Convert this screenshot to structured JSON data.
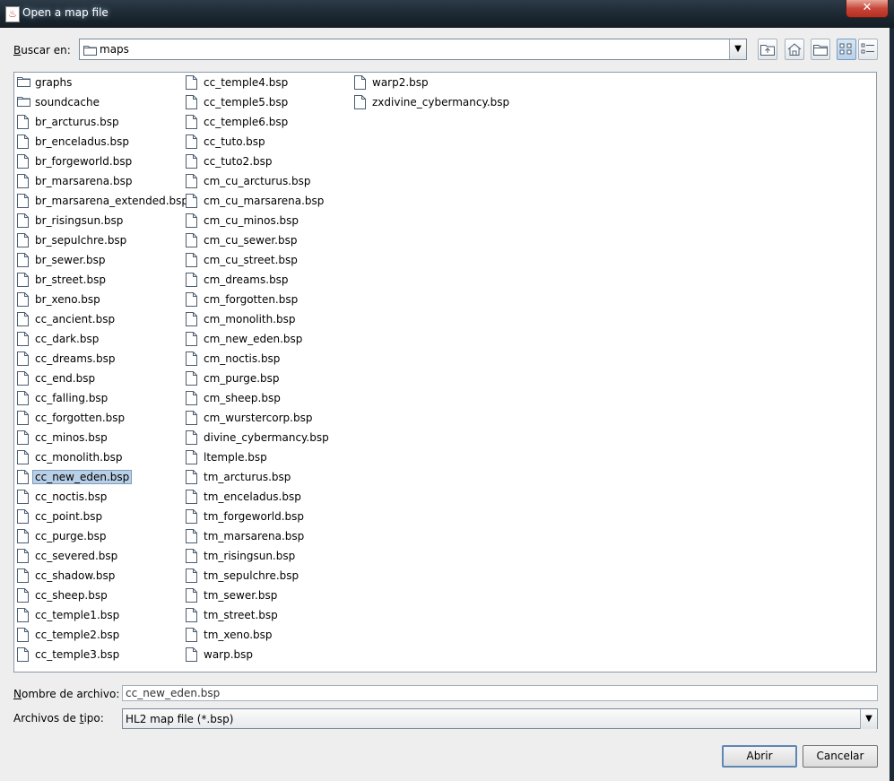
{
  "window": {
    "title": "Open a map file",
    "close_label": "✕"
  },
  "lookin": {
    "label_prefix": "B",
    "label_rest": "uscar en:",
    "value": "maps"
  },
  "files": {
    "columns": [
      [
        {
          "name": "graphs",
          "type": "folder"
        },
        {
          "name": "soundcache",
          "type": "folder"
        },
        {
          "name": "br_arcturus.bsp",
          "type": "file"
        },
        {
          "name": "br_enceladus.bsp",
          "type": "file"
        },
        {
          "name": "br_forgeworld.bsp",
          "type": "file"
        },
        {
          "name": "br_marsarena.bsp",
          "type": "file"
        },
        {
          "name": "br_marsarena_extended.bsp",
          "type": "file"
        },
        {
          "name": "br_risingsun.bsp",
          "type": "file"
        },
        {
          "name": "br_sepulchre.bsp",
          "type": "file"
        },
        {
          "name": "br_sewer.bsp",
          "type": "file"
        },
        {
          "name": "br_street.bsp",
          "type": "file"
        },
        {
          "name": "br_xeno.bsp",
          "type": "file"
        },
        {
          "name": "cc_ancient.bsp",
          "type": "file"
        },
        {
          "name": "cc_dark.bsp",
          "type": "file"
        },
        {
          "name": "cc_dreams.bsp",
          "type": "file"
        },
        {
          "name": "cc_end.bsp",
          "type": "file"
        },
        {
          "name": "cc_falling.bsp",
          "type": "file"
        },
        {
          "name": "cc_forgotten.bsp",
          "type": "file"
        },
        {
          "name": "cc_minos.bsp",
          "type": "file"
        },
        {
          "name": "cc_monolith.bsp",
          "type": "file"
        },
        {
          "name": "cc_new_eden.bsp",
          "type": "file",
          "selected": true
        },
        {
          "name": "cc_noctis.bsp",
          "type": "file"
        },
        {
          "name": "cc_point.bsp",
          "type": "file"
        },
        {
          "name": "cc_purge.bsp",
          "type": "file"
        },
        {
          "name": "cc_severed.bsp",
          "type": "file"
        },
        {
          "name": "cc_shadow.bsp",
          "type": "file"
        },
        {
          "name": "cc_sheep.bsp",
          "type": "file"
        },
        {
          "name": "cc_temple1.bsp",
          "type": "file"
        },
        {
          "name": "cc_temple2.bsp",
          "type": "file"
        },
        {
          "name": "cc_temple3.bsp",
          "type": "file"
        }
      ],
      [
        {
          "name": "cc_temple4.bsp",
          "type": "file"
        },
        {
          "name": "cc_temple5.bsp",
          "type": "file"
        },
        {
          "name": "cc_temple6.bsp",
          "type": "file"
        },
        {
          "name": "cc_tuto.bsp",
          "type": "file"
        },
        {
          "name": "cc_tuto2.bsp",
          "type": "file"
        },
        {
          "name": "cm_cu_arcturus.bsp",
          "type": "file"
        },
        {
          "name": "cm_cu_marsarena.bsp",
          "type": "file"
        },
        {
          "name": "cm_cu_minos.bsp",
          "type": "file"
        },
        {
          "name": "cm_cu_sewer.bsp",
          "type": "file"
        },
        {
          "name": "cm_cu_street.bsp",
          "type": "file"
        },
        {
          "name": "cm_dreams.bsp",
          "type": "file"
        },
        {
          "name": "cm_forgotten.bsp",
          "type": "file"
        },
        {
          "name": "cm_monolith.bsp",
          "type": "file"
        },
        {
          "name": "cm_new_eden.bsp",
          "type": "file"
        },
        {
          "name": "cm_noctis.bsp",
          "type": "file"
        },
        {
          "name": "cm_purge.bsp",
          "type": "file"
        },
        {
          "name": "cm_sheep.bsp",
          "type": "file"
        },
        {
          "name": "cm_wurstercorp.bsp",
          "type": "file"
        },
        {
          "name": "divine_cybermancy.bsp",
          "type": "file"
        },
        {
          "name": "ltemple.bsp",
          "type": "file"
        },
        {
          "name": "tm_arcturus.bsp",
          "type": "file"
        },
        {
          "name": "tm_enceladus.bsp",
          "type": "file"
        },
        {
          "name": "tm_forgeworld.bsp",
          "type": "file"
        },
        {
          "name": "tm_marsarena.bsp",
          "type": "file"
        },
        {
          "name": "tm_risingsun.bsp",
          "type": "file"
        },
        {
          "name": "tm_sepulchre.bsp",
          "type": "file"
        },
        {
          "name": "tm_sewer.bsp",
          "type": "file"
        },
        {
          "name": "tm_street.bsp",
          "type": "file"
        },
        {
          "name": "tm_xeno.bsp",
          "type": "file"
        },
        {
          "name": "warp.bsp",
          "type": "file"
        }
      ],
      [
        {
          "name": "warp2.bsp",
          "type": "file"
        },
        {
          "name": "zxdivine_cybermancy.bsp",
          "type": "file"
        }
      ]
    ]
  },
  "filename": {
    "label_prefix": "N",
    "label_rest": "ombre de archivo:",
    "value": "cc_new_eden.bsp"
  },
  "filetype": {
    "label_prefix": "Archivos de ",
    "label_u": "t",
    "label_rest": "ipo:",
    "value": "HL2 map file (*.bsp)"
  },
  "buttons": {
    "open": "Abrir",
    "cancel": "Cancelar"
  },
  "colors": {
    "selection": "#b8cfe5",
    "dialog_bg": "#eeeeee"
  }
}
